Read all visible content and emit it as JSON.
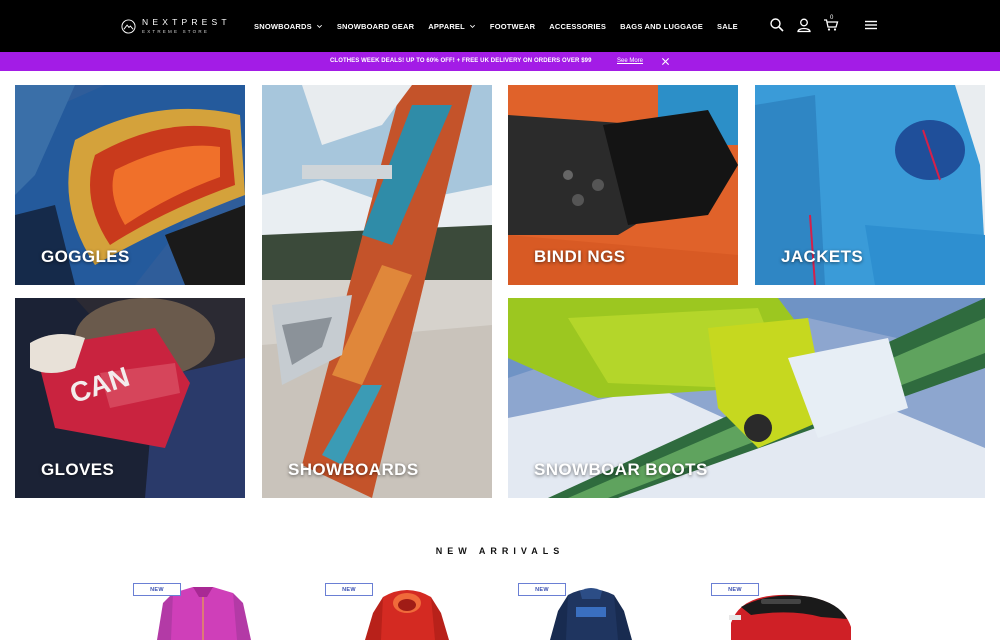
{
  "header": {
    "logo_name": "NEXTPREST",
    "logo_sub": "EXTREME STORE",
    "nav": [
      {
        "label": "SNOWBOARDS",
        "has_dropdown": true
      },
      {
        "label": "SNOWBOARD GEAR",
        "has_dropdown": false
      },
      {
        "label": "APPAREL",
        "has_dropdown": true
      },
      {
        "label": "FOOTWEAR",
        "has_dropdown": false
      },
      {
        "label": "ACCESSORIES",
        "has_dropdown": false
      },
      {
        "label": "BAGS AND LUGGAGE",
        "has_dropdown": false
      },
      {
        "label": "SALE",
        "has_dropdown": false
      }
    ],
    "icons": [
      "search-icon",
      "user-icon",
      "cart-icon",
      "menu-icon"
    ],
    "cart_count": "0"
  },
  "promo": {
    "text": "CLOTHES WEEK DEALS! UP TO 60% OFF! + FREE UK DELIVERY ON ORDERS OVER $99",
    "link": "See More",
    "background": "#a31ce6"
  },
  "categories": [
    {
      "label": "GOGGLES"
    },
    {
      "label": "SHOWBOARDS"
    },
    {
      "label": "BINDI NGS"
    },
    {
      "label": "JACKETS"
    },
    {
      "label": "GLOVES"
    },
    {
      "label": "SNOWBOAR BOOTS"
    }
  ],
  "new_arrivals": {
    "title": "NEW ARRIVALS",
    "products": [
      {
        "badge": "NEW",
        "item": "pink-jacket"
      },
      {
        "badge": "NEW",
        "item": "red-hooded-jacket"
      },
      {
        "badge": "NEW",
        "item": "navy-jacket"
      },
      {
        "badge": "NEW",
        "item": "red-helmet"
      }
    ]
  },
  "colors": {
    "header_bg": "#000000",
    "promo_bg": "#a31ce6",
    "badge_border": "#6a7fd4"
  }
}
